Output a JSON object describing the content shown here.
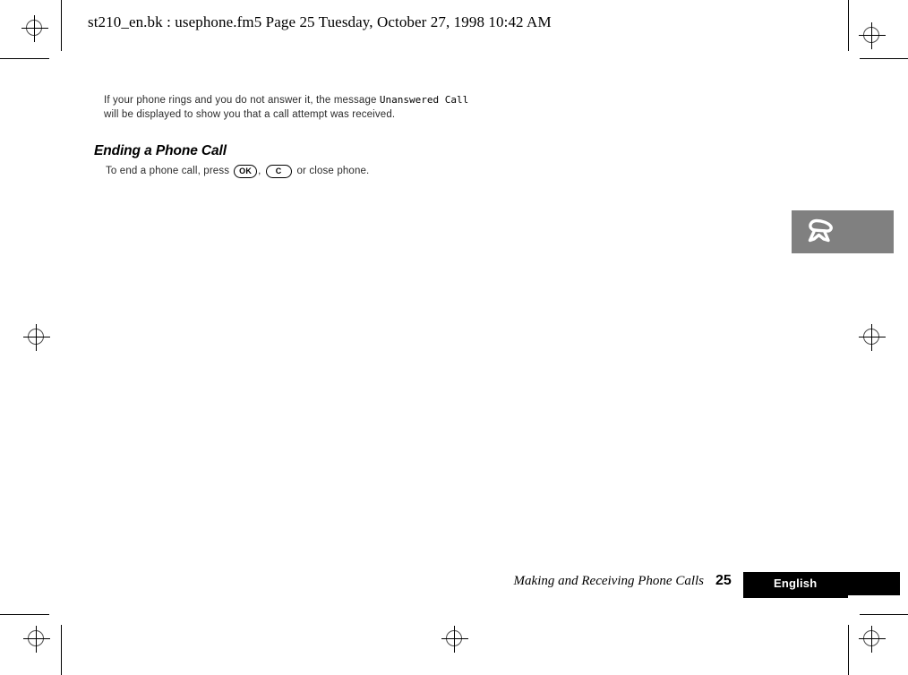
{
  "header": {
    "text": "st210_en.bk : usephone.fm5  Page 25  Tuesday, October 27, 1998  10:42 AM"
  },
  "body": {
    "paragraph_part1": "If your phone rings and you do not answer it, the message",
    "paragraph_mono": "Unanswered Call",
    "paragraph_part2": "will be displayed to show you that a call attempt was received.",
    "section_heading": "Ending a Phone Call",
    "instruction_part1": "To end a phone call, press",
    "instruction_comma": ",",
    "instruction_part2": "or close phone.",
    "key_ok_label": "OK",
    "key_c_label": "C"
  },
  "thumb_tab": {
    "icon_name": "phone-handset-icon",
    "background_color": "#808080"
  },
  "footer": {
    "chapter_title": "Making and Receiving Phone Calls",
    "page_number": "25",
    "language": "English",
    "bar_color": "#000000"
  },
  "print_marks": {
    "registration_mark_name": "registration-target-mark",
    "crop_line_name": "crop-trim-line"
  }
}
